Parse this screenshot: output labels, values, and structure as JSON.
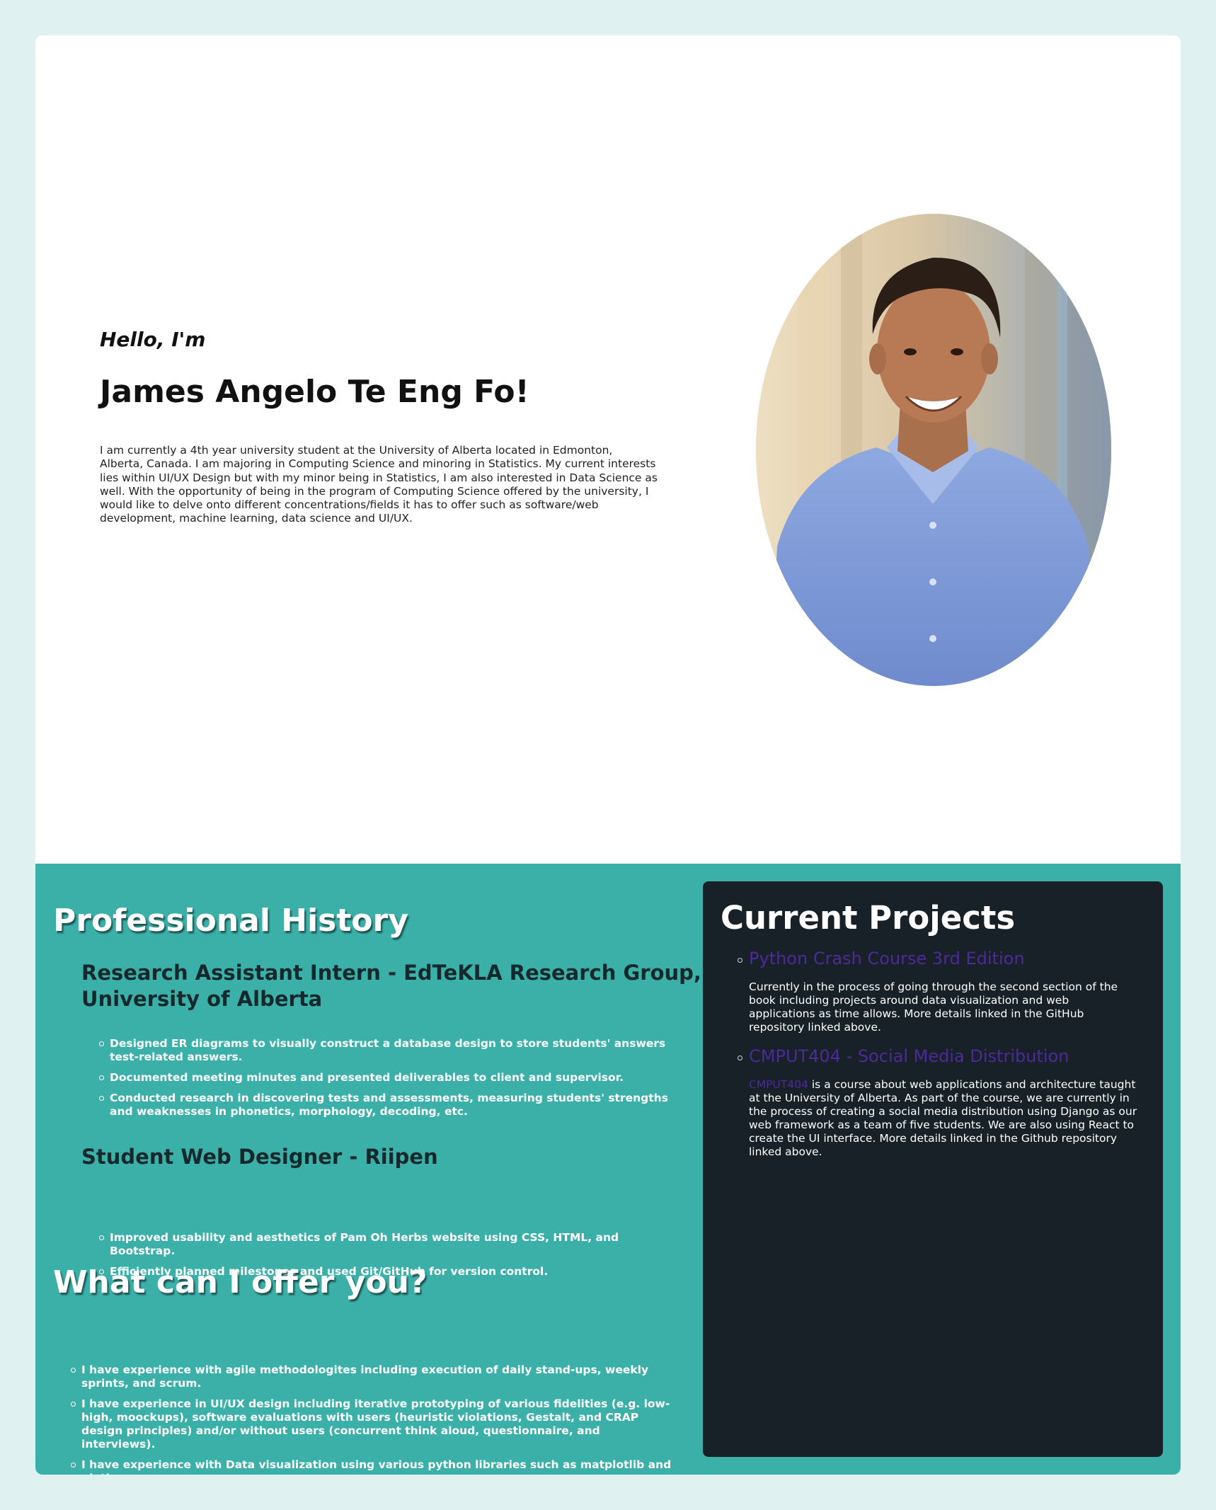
{
  "hero": {
    "greeting": "Hello, I'm",
    "name": "James Angelo Te Eng Fo!",
    "bio": "I am currently a 4th year university student at the University of Alberta located in Edmonton, Alberta, Canada. I am majoring in Computing Science and minoring in Statistics. My current interests lies within UI/UX Design but with my minor being in Statistics, I am also interested in Data Science as well. With the opportunity of being in the program of Computing Science offered by the university, I would like to delve onto different concentrations/fields it has to offer such as software/web development, machine learning, data science and UI/UX."
  },
  "history": {
    "title": "Professional History",
    "jobs": [
      {
        "title": "Research Assistant Intern - EdTeKLA Research Group, University of Alberta",
        "bullets": [
          "Designed ER diagrams to visually construct a database design to store students' answers test-related answers.",
          "Documented meeting minutes and presented deliverables to client and supervisor.",
          "Conducted research in discovering tests and assessments, measuring students' strengths and weaknesses in phonetics, morphology, decoding, etc."
        ]
      },
      {
        "title": "Student Web Designer - Riipen",
        "bullets": [
          "Improved usability and aesthetics of Pam Oh Herbs website using CSS, HTML, and Bootstrap.",
          "Efficiently planned milestones and used Git/GitHub for version control."
        ]
      }
    ]
  },
  "offer": {
    "title": "What can I offer you?",
    "bullets": [
      "I have experience with agile methodologites including execution of daily stand-ups, weekly sprints, and scrum.",
      "I have experience in UI/UX design including iterative prototyping of various fidelities (e.g. low-high, moockups), software evaluations with users (heuristic violations, Gestalt, and CRAP design principles) and/or without users (concurrent think aloud, questionnaire, and interviews).",
      "I have experience with Data visualization using various python libraries such as matplotlib and plotly express."
    ]
  },
  "projects": {
    "title": "Current Projects",
    "items": [
      {
        "link": "Python Crash Course 3rd Edition",
        "desc": "Currently in the process of going through the second section of the book including projects around data visualization and web applications as time allows. More details linked in the GitHub repository linked above."
      },
      {
        "link": "CMPUT404 - Social Media Distribution",
        "inline_link": "CMPUT404",
        "desc": " is a course about web applications and architecture taught at the University of Alberta. As part of the course, we are currently in the process of creating a social media distribution using Django as our web framework as a team of five students. We are also using React to create the UI interface. More details linked in the Github repository linked above."
      }
    ]
  },
  "colors": {
    "page_bg": "#dff1f0",
    "teal": "#3bb0a9",
    "panel_dark": "#172127",
    "link_purple": "#4c2a9b",
    "shirt_blue": "#7f9bd6"
  },
  "portrait": {
    "icon": "profile-photo"
  }
}
